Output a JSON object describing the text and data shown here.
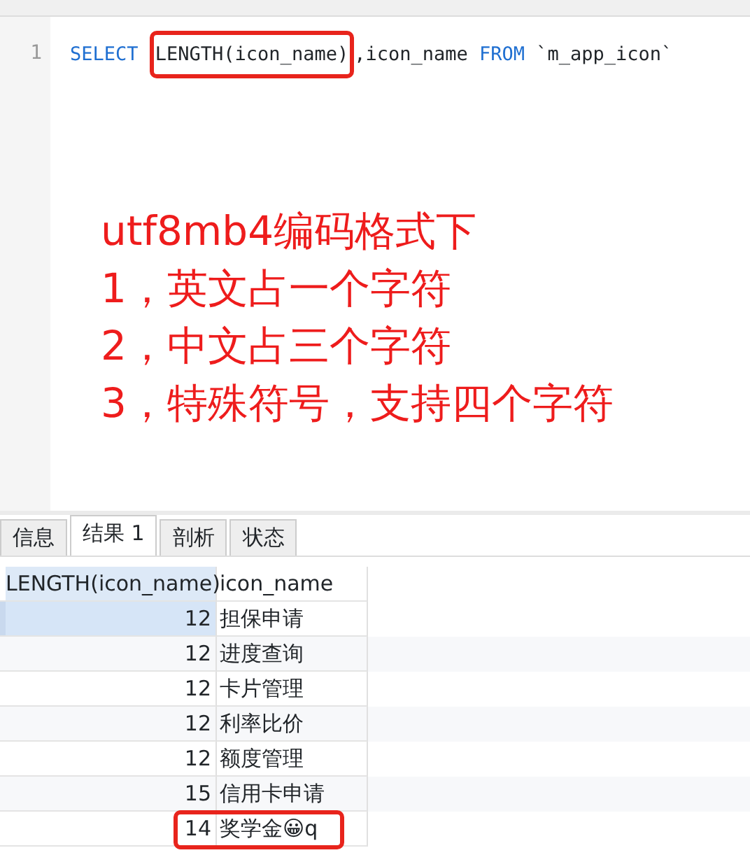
{
  "editor": {
    "line_number": "1",
    "segments": [
      {
        "text": "SELECT ",
        "kind": "keyword",
        "highlighted": false
      },
      {
        "text": "LENGTH(icon_name)",
        "kind": "plain",
        "highlighted": true
      },
      {
        "text": ",icon_name ",
        "kind": "plain",
        "highlighted": false
      },
      {
        "text": "FROM",
        "kind": "keyword",
        "highlighted": false
      },
      {
        "text": " `m_app_icon`",
        "kind": "plain",
        "highlighted": false
      }
    ]
  },
  "annotation": [
    "utf8mb4编码格式下",
    "1，英文占一个字符",
    "2，中文占三个字符",
    "3，特殊符号，支持四个字符"
  ],
  "result_tabs": [
    {
      "label": "信息",
      "selected": false
    },
    {
      "label": "结果 1",
      "selected": true
    },
    {
      "label": "剖析",
      "selected": false
    },
    {
      "label": "状态",
      "selected": false
    }
  ],
  "grid": {
    "columns": [
      "LENGTH(icon_name)",
      "icon_name"
    ],
    "rows": [
      {
        "length": "12",
        "icon_name": "担保申请",
        "selected": true,
        "highlighted": false
      },
      {
        "length": "12",
        "icon_name": "进度查询",
        "selected": false,
        "highlighted": false
      },
      {
        "length": "12",
        "icon_name": "卡片管理",
        "selected": false,
        "highlighted": false
      },
      {
        "length": "12",
        "icon_name": "利率比价",
        "selected": false,
        "highlighted": false
      },
      {
        "length": "12",
        "icon_name": "额度管理",
        "selected": false,
        "highlighted": false
      },
      {
        "length": "15",
        "icon_name": "信用卡申请",
        "selected": false,
        "highlighted": false
      },
      {
        "length": "14",
        "icon_name": "奖学金😀q",
        "selected": false,
        "highlighted": true
      }
    ]
  }
}
